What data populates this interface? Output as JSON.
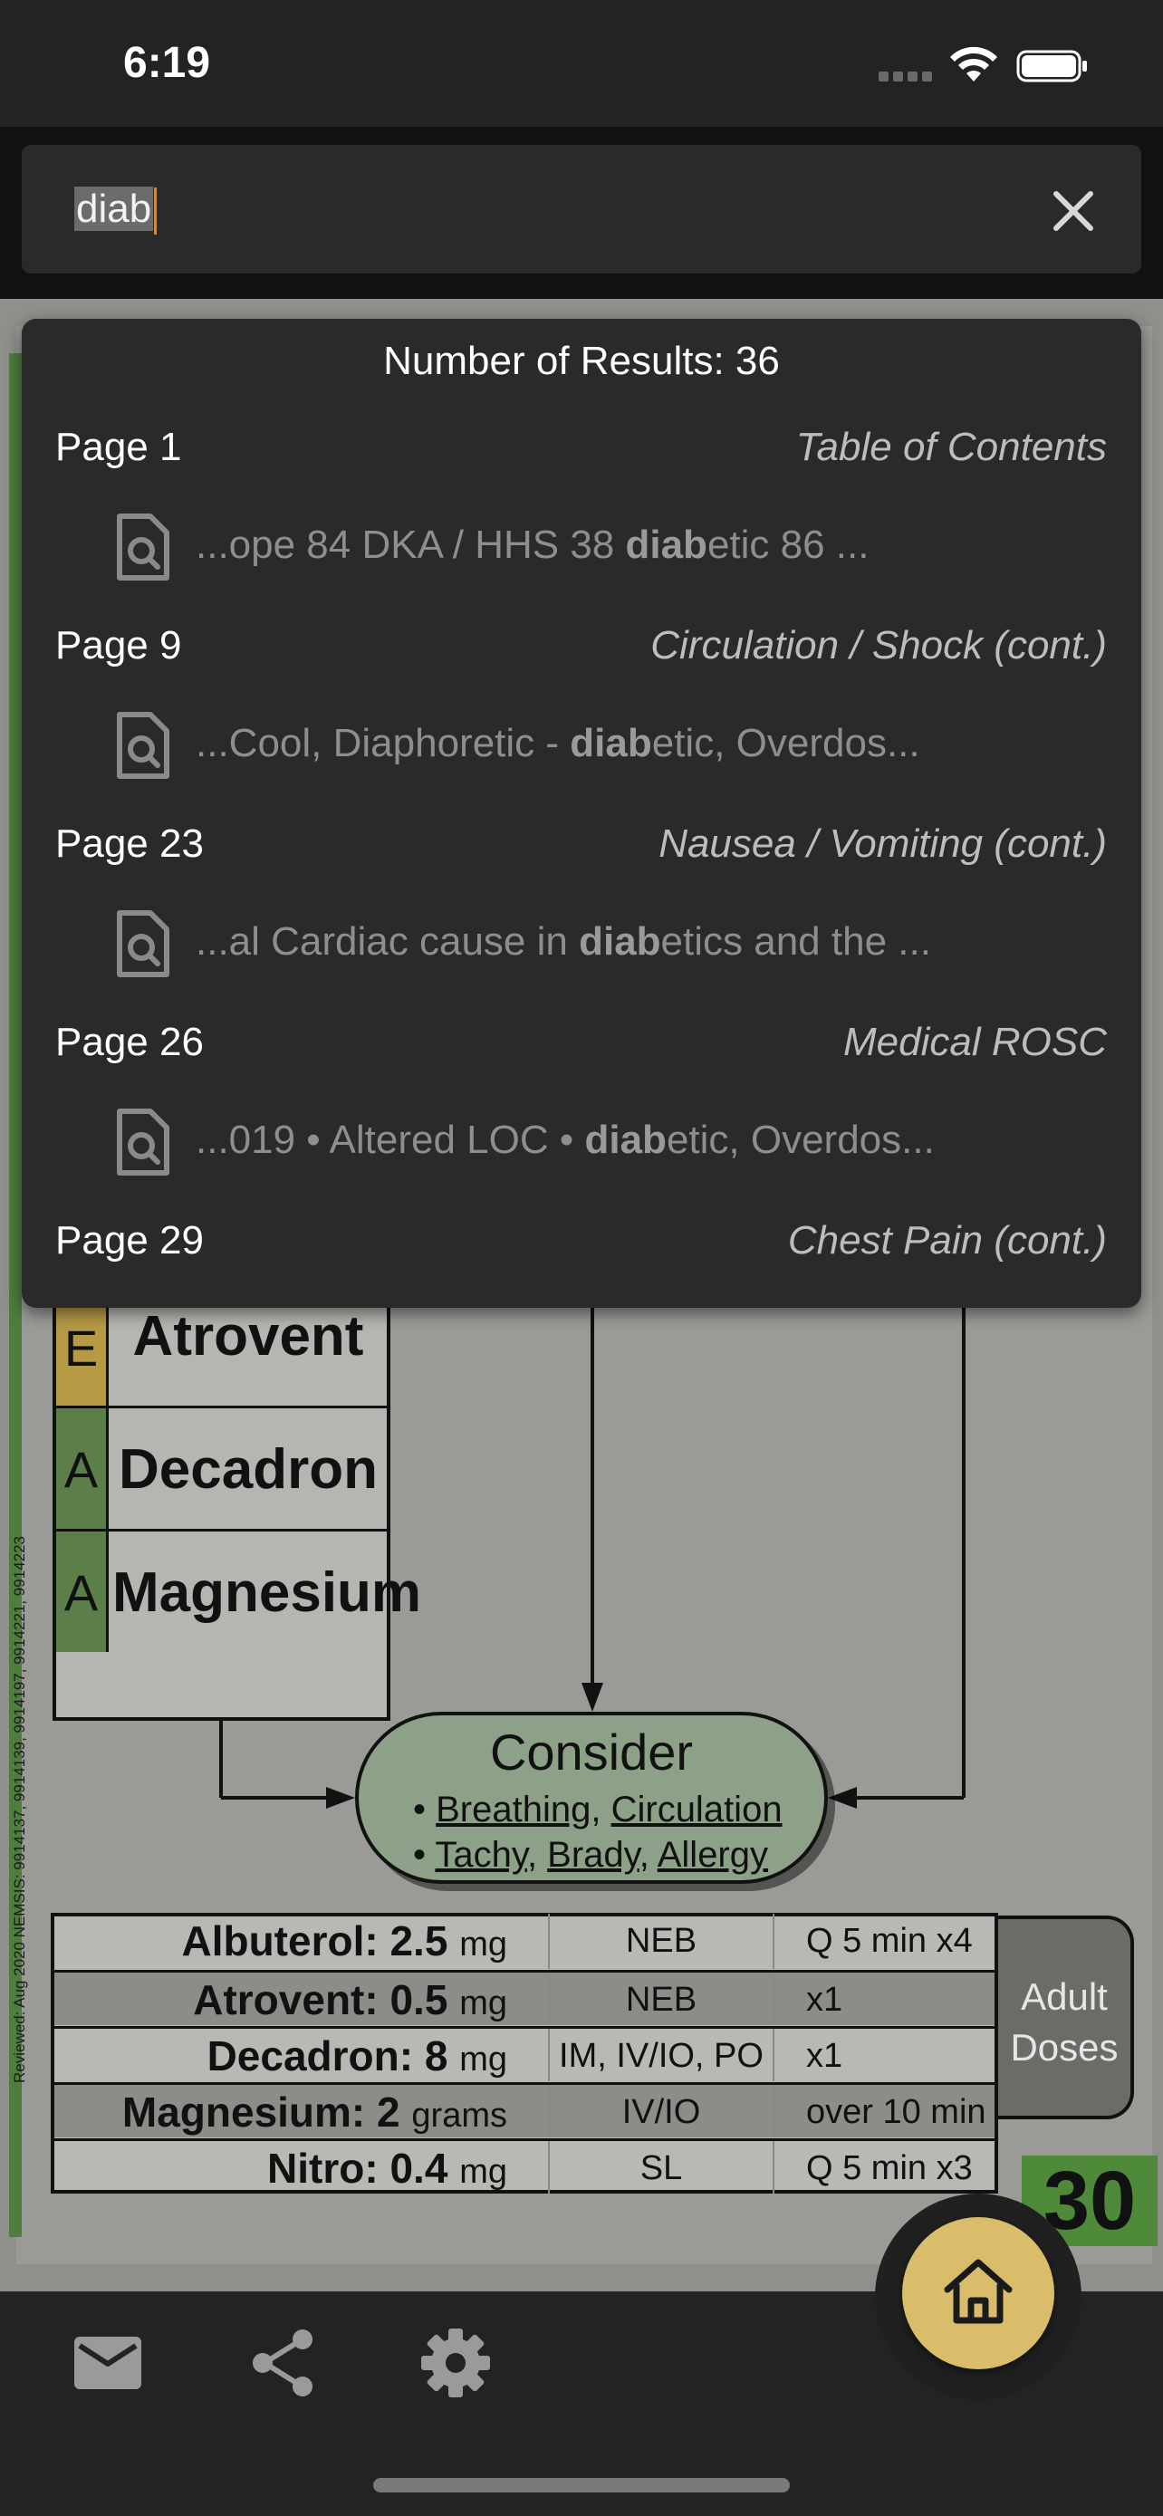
{
  "status_bar": {
    "time": "6:19"
  },
  "search": {
    "value": "diab"
  },
  "results": {
    "count_label": "Number of Results: 36",
    "items": [
      {
        "page": "Page 1",
        "section": "Table of Contents",
        "snippet_pre": "...ope 84 DKA / HHS 38 ",
        "snippet_match": "diab",
        "snippet_post": "etic 86 ..."
      },
      {
        "page": "Page 9",
        "section": "Circulation / Shock (cont.)",
        "snippet_pre": "...Cool, Diaphoretic - ",
        "snippet_match": "diab",
        "snippet_post": "etic, Overdos..."
      },
      {
        "page": "Page 23",
        "section": "Nausea / Vomiting (cont.)",
        "snippet_pre": "...al Cardiac cause in ",
        "snippet_match": "diab",
        "snippet_post": "etics and the ..."
      },
      {
        "page": "Page 26",
        "section": "Medical ROSC",
        "snippet_pre": "...019 • Altered LOC • ",
        "snippet_match": "diab",
        "snippet_post": "etic, Overdos..."
      },
      {
        "page": "Page 29",
        "section": "Chest Pain (cont.)"
      }
    ]
  },
  "document": {
    "vertical_note": "Reviewed: Aug 2020      NEMSIS: 9914137, 9914139, 9914197, 9914221, 9914223",
    "meds": [
      {
        "letter": "E",
        "name": "Atrovent",
        "color": "#b69a45"
      },
      {
        "letter": "A",
        "name": "Decadron",
        "color": "#5c7f4a"
      },
      {
        "letter": "A",
        "name": "Magnesium",
        "color": "#5c7f4a"
      }
    ],
    "consider": {
      "title": "Consider",
      "line1_a": "Breathing",
      "line1_b": "Circulation",
      "line2_a": "Tachy",
      "line2_b": "Brady",
      "line2_c": "Allergy"
    },
    "doses": [
      {
        "drug": "Albuterol:",
        "amount": "2.5",
        "unit": "mg",
        "route": "NEB",
        "freq": "Q 5 min x4"
      },
      {
        "drug": "Atrovent:",
        "amount": "0.5",
        "unit": "mg",
        "route": "NEB",
        "freq": "x1"
      },
      {
        "drug": "Decadron:",
        "amount": "8",
        "unit": "mg",
        "route": "IM, IV/IO, PO",
        "freq": "x1"
      },
      {
        "drug": "Magnesium:",
        "amount": "2",
        "unit": "grams",
        "route": "IV/IO",
        "freq": "over 10 min"
      },
      {
        "drug": "Nitro:",
        "amount": "0.4",
        "unit": "mg",
        "route": "SL",
        "freq": "Q 5 min x3"
      }
    ],
    "adult_doses_line1": "Adult",
    "adult_doses_line2": "Doses",
    "page_number": "30"
  },
  "icons": {
    "mail": "mail-icon",
    "share": "share-icon",
    "settings": "gear-icon",
    "home": "home-icon",
    "clear": "close-icon",
    "result": "document-search-icon"
  },
  "colors": {
    "accent_home": "#d9bd6b",
    "results_bg": "#2a2a2a",
    "page_green": "#4e8a3a"
  }
}
